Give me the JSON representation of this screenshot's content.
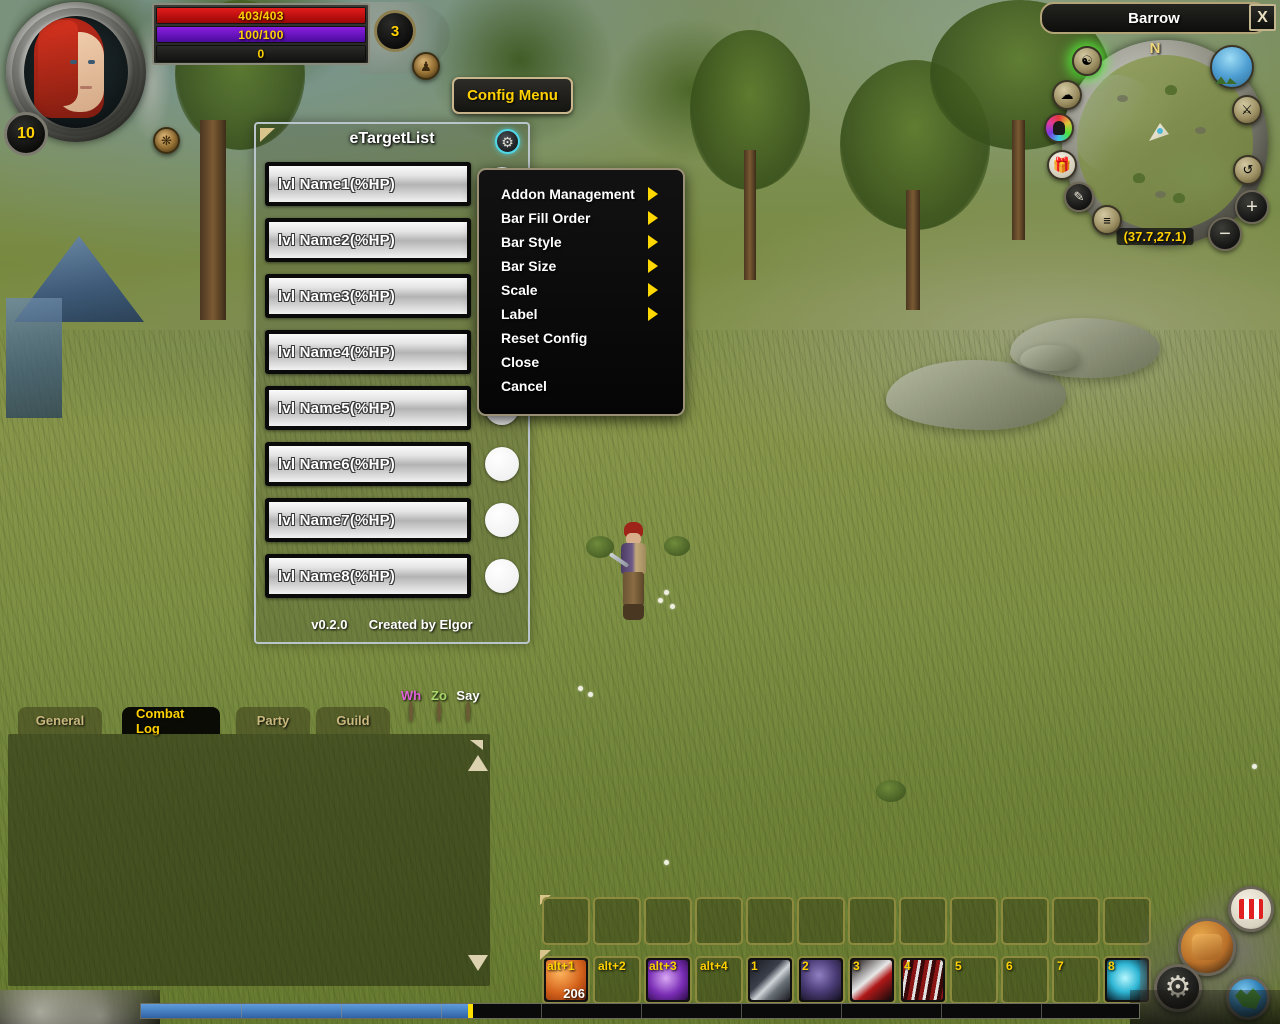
{
  "world": {
    "zone_name": "Barrow",
    "coordinates": "(37.7,27.1)",
    "north_label": "N"
  },
  "player_frame": {
    "level": "10",
    "health": "403/403",
    "mana": "100/100",
    "energy": "0",
    "rest_count": "3",
    "add_member_icon": "add-member-icon",
    "pet_icon": "pet-paw-icon"
  },
  "config_menu_button": {
    "label": "Config Menu"
  },
  "etargetlist": {
    "title": "eTargetList",
    "gear_icon": "gear-icon",
    "version": "v0.2.0",
    "author": "Created by Elgor",
    "rows": [
      {
        "label": "lvl Name1(%HP)"
      },
      {
        "label": "lvl Name2(%HP)"
      },
      {
        "label": "lvl Name3(%HP)"
      },
      {
        "label": "lvl Name4(%HP)"
      },
      {
        "label": "lvl Name5(%HP)"
      },
      {
        "label": "lvl Name6(%HP)"
      },
      {
        "label": "lvl Name7(%HP)"
      },
      {
        "label": "lvl Name8(%HP)"
      }
    ]
  },
  "context_menu": {
    "items": [
      {
        "label": "Addon Management",
        "submenu": true
      },
      {
        "label": "Bar Fill Order",
        "submenu": true
      },
      {
        "label": "Bar Style",
        "submenu": true
      },
      {
        "label": "Bar Size",
        "submenu": true
      },
      {
        "label": "Scale",
        "submenu": true
      },
      {
        "label": "Label",
        "submenu": true
      },
      {
        "label": "Reset Config",
        "submenu": false
      },
      {
        "label": "Close",
        "submenu": false
      },
      {
        "label": "Cancel",
        "submenu": false
      }
    ],
    "arrow_color": "#ffd800"
  },
  "minimap": {
    "close_label": "X",
    "buttons_left": [
      {
        "name": "tracking-icon",
        "glyph": "⚜",
        "glow": true
      },
      {
        "name": "weather-cloud-icon",
        "glyph": "☁",
        "glow": false
      },
      {
        "name": "rainbow-portrait-icon",
        "glyph": "",
        "glow": false
      },
      {
        "name": "gift-icon",
        "glyph": "",
        "glow": false
      },
      {
        "name": "notes-icon",
        "glyph": "✎",
        "glow": false
      },
      {
        "name": "quest-log-icon",
        "glyph": "≡",
        "glow": false
      }
    ],
    "buttons_right": [
      {
        "name": "day-night-icon",
        "glyph": ""
      },
      {
        "name": "pvp-swords-icon",
        "glyph": "⚔"
      },
      {
        "name": "clock-icon",
        "glyph": "↺"
      },
      {
        "name": "zoom-in-icon",
        "glyph": "+"
      },
      {
        "name": "zoom-out-icon",
        "glyph": "−"
      }
    ]
  },
  "chat": {
    "tabs": [
      {
        "label": "General",
        "active": false
      },
      {
        "label": "Combat Log",
        "active": true
      },
      {
        "label": "Party",
        "active": false
      },
      {
        "label": "Guild",
        "active": false
      }
    ],
    "voice_buttons": [
      {
        "label": "Wh",
        "color": "#e060d8",
        "orb": "#a83fa0"
      },
      {
        "label": "Zo",
        "color": "#a8d86a",
        "orb": "#8fae66"
      },
      {
        "label": "Say",
        "color": "#ffffff",
        "orb": "#c8c8c8"
      }
    ],
    "scroll_up_icon": "scroll-up-arrow-icon",
    "scroll_down_icon": "scroll-down-arrow-icon"
  },
  "action_bars": {
    "top_row": [
      {
        "key": "",
        "icon": "",
        "count": ""
      },
      {
        "key": "",
        "icon": "",
        "count": ""
      },
      {
        "key": "",
        "icon": "",
        "count": ""
      },
      {
        "key": "",
        "icon": "",
        "count": ""
      },
      {
        "key": "",
        "icon": "",
        "count": ""
      },
      {
        "key": "",
        "icon": "",
        "count": ""
      },
      {
        "key": "",
        "icon": "",
        "count": ""
      },
      {
        "key": "",
        "icon": "",
        "count": ""
      },
      {
        "key": "",
        "icon": "",
        "count": ""
      },
      {
        "key": "",
        "icon": "",
        "count": ""
      },
      {
        "key": "",
        "icon": "",
        "count": ""
      },
      {
        "key": "",
        "icon": "",
        "count": ""
      }
    ],
    "bottom_row": [
      {
        "key": "alt+1",
        "icon": "ic-potion",
        "count": "206"
      },
      {
        "key": "alt+2",
        "icon": "",
        "count": ""
      },
      {
        "key": "alt+3",
        "icon": "ic-shadow",
        "count": ""
      },
      {
        "key": "alt+4",
        "icon": "",
        "count": ""
      },
      {
        "key": "1",
        "icon": "ic-dagger",
        "count": ""
      },
      {
        "key": "2",
        "icon": "ic-stealth",
        "count": ""
      },
      {
        "key": "3",
        "icon": "ic-bleed",
        "count": ""
      },
      {
        "key": "4",
        "icon": "ic-claw",
        "count": ""
      },
      {
        "key": "5",
        "icon": "",
        "count": ""
      },
      {
        "key": "6",
        "icon": "",
        "count": ""
      },
      {
        "key": "7",
        "icon": "",
        "count": ""
      },
      {
        "key": "8",
        "icon": "ic-frost",
        "count": ""
      }
    ]
  },
  "bottom_right": {
    "gift_icon": "gift-icon",
    "backpack_icon": "backpack-icon",
    "settings_gear_icon": "settings-gear-icon",
    "world_map_icon": "world-map-globe-icon"
  },
  "xp_bar": {
    "percent": 33
  },
  "colors": {
    "health": "#e21c1c",
    "mana": "#8a1ee0",
    "accent_yellow": "#ffd100",
    "menu_arrow": "#ffd800",
    "gear_ring": "#4fd8e8",
    "xp_fill": "#5f9ddb"
  }
}
